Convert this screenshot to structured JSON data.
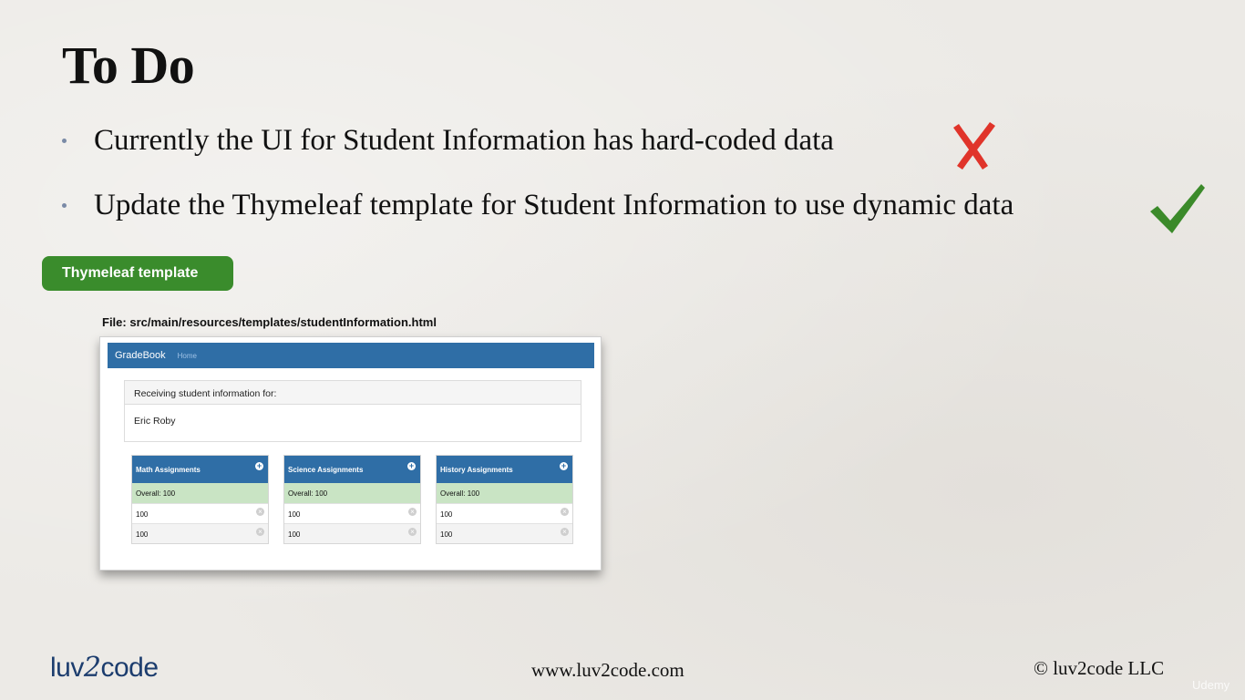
{
  "slide": {
    "title": "To Do",
    "bullets": [
      "Currently the UI for Student Information has hard-coded data",
      "Update the Thymeleaf template for Student Information to use dynamic data"
    ]
  },
  "marks": {
    "bullet1_icon": "red-x-icon",
    "bullet2_icon": "green-check-icon"
  },
  "tag_label": "Thymeleaf template",
  "file_path": "File: src/main/resources/templates/studentInformation.html",
  "app": {
    "brand": "GradeBook",
    "nav_home": "Home",
    "info_heading": "Receiving student information for:",
    "student_name": "Eric Roby",
    "panels": [
      {
        "title": "Math Assignments",
        "overall": "Overall: 100",
        "grades": [
          "100",
          "100"
        ]
      },
      {
        "title": "Science Assignments",
        "overall": "Overall: 100",
        "grades": [
          "100",
          "100"
        ]
      },
      {
        "title": "History Assignments",
        "overall": "Overall: 100",
        "grades": [
          "100",
          "100"
        ]
      }
    ]
  },
  "footer": {
    "logo_prefix": "luv",
    "logo_two": "2",
    "logo_suffix": "code",
    "url": "www.luv2code.com",
    "copyright": "© luv2code LLC"
  },
  "watermark": "Udemy",
  "colors": {
    "accent_green": "#3a8c2c",
    "navbar_blue": "#2f6ea6",
    "cross_red": "#e0342a",
    "check_green": "#3b8a2a"
  }
}
